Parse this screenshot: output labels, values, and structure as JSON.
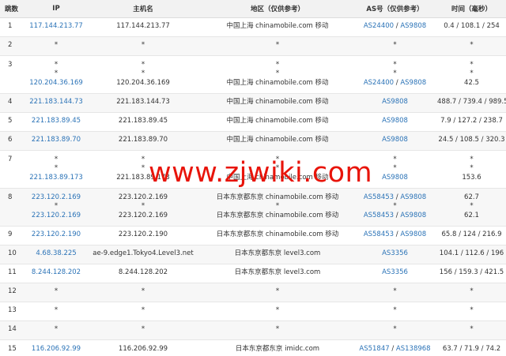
{
  "headers": {
    "hop": "跳数",
    "ip": "IP",
    "host": "主机名",
    "region": "地区（仅供参考）",
    "as": "AS号（仅供参考）",
    "time": "时间（毫秒）"
  },
  "rows": [
    {
      "hop": "1",
      "lines": [
        {
          "ip": "117.144.213.77",
          "host": "117.144.213.77",
          "region": "中国上海 chinamobile.com 移动",
          "as": [
            "AS24400",
            "AS9808"
          ],
          "time": "0.4 / 108.1 / 254"
        }
      ]
    },
    {
      "hop": "2",
      "lines": [
        {
          "ip": "*",
          "host": "*",
          "region": "*",
          "as": [
            "*"
          ],
          "time": "*"
        }
      ]
    },
    {
      "hop": "3",
      "lines": [
        {
          "ip": "*",
          "host": "*",
          "region": "*",
          "as": [
            "*"
          ],
          "time": "*"
        },
        {
          "ip": "*",
          "host": "*",
          "region": "*",
          "as": [
            "*"
          ],
          "time": "*"
        },
        {
          "ip": "120.204.36.169",
          "host": "120.204.36.169",
          "region": "中国上海 chinamobile.com 移动",
          "as": [
            "AS24400",
            "AS9808"
          ],
          "time": "42.5"
        }
      ]
    },
    {
      "hop": "4",
      "lines": [
        {
          "ip": "221.183.144.73",
          "host": "221.183.144.73",
          "region": "中国上海 chinamobile.com 移动",
          "as": [
            "AS9808"
          ],
          "time": "488.7 / 739.4 / 989.5"
        }
      ]
    },
    {
      "hop": "5",
      "lines": [
        {
          "ip": "221.183.89.45",
          "host": "221.183.89.45",
          "region": "中国上海 chinamobile.com 移动",
          "as": [
            "AS9808"
          ],
          "time": "7.9 / 127.2 / 238.7"
        }
      ]
    },
    {
      "hop": "6",
      "lines": [
        {
          "ip": "221.183.89.70",
          "host": "221.183.89.70",
          "region": "中国上海 chinamobile.com 移动",
          "as": [
            "AS9808"
          ],
          "time": "24.5 / 108.5 / 320.3"
        }
      ]
    },
    {
      "hop": "7",
      "lines": [
        {
          "ip": "*",
          "host": "*",
          "region": "*",
          "as": [
            "*"
          ],
          "time": "*"
        },
        {
          "ip": "*",
          "host": "*",
          "region": "*",
          "as": [
            "*"
          ],
          "time": "*"
        },
        {
          "ip": "221.183.89.173",
          "host": "221.183.89.173",
          "region": "中国上海 chinamobile.com 移动",
          "as": [
            "AS9808"
          ],
          "time": "153.6"
        }
      ]
    },
    {
      "hop": "8",
      "lines": [
        {
          "ip": "223.120.2.169",
          "host": "223.120.2.169",
          "region": "日本东京都东京 chinamobile.com 移动",
          "as": [
            "AS58453",
            "AS9808"
          ],
          "time": "62.7"
        },
        {
          "ip": "*",
          "host": "*",
          "region": "*",
          "as": [
            "*"
          ],
          "time": "*"
        },
        {
          "ip": "223.120.2.169",
          "host": "223.120.2.169",
          "region": "日本东京都东京 chinamobile.com 移动",
          "as": [
            "AS58453",
            "AS9808"
          ],
          "time": "62.1"
        }
      ]
    },
    {
      "hop": "9",
      "lines": [
        {
          "ip": "223.120.2.190",
          "host": "223.120.2.190",
          "region": "日本东京都东京 chinamobile.com 移动",
          "as": [
            "AS58453",
            "AS9808"
          ],
          "time": "65.8 / 124 / 216.9"
        }
      ]
    },
    {
      "hop": "10",
      "lines": [
        {
          "ip": "4.68.38.225",
          "host": "ae-9.edge1.Tokyo4.Level3.net",
          "region": "日本东京都东京 level3.com",
          "as": [
            "AS3356"
          ],
          "time": "104.1 / 112.6 / 196"
        }
      ]
    },
    {
      "hop": "11",
      "lines": [
        {
          "ip": "8.244.128.202",
          "host": "8.244.128.202",
          "region": "日本东京都东京 level3.com",
          "as": [
            "AS3356"
          ],
          "time": "156 / 159.3 / 421.5"
        }
      ]
    },
    {
      "hop": "12",
      "lines": [
        {
          "ip": "*",
          "host": "*",
          "region": "*",
          "as": [
            "*"
          ],
          "time": "*"
        }
      ]
    },
    {
      "hop": "13",
      "lines": [
        {
          "ip": "*",
          "host": "*",
          "region": "*",
          "as": [
            "*"
          ],
          "time": "*"
        }
      ]
    },
    {
      "hop": "14",
      "lines": [
        {
          "ip": "*",
          "host": "*",
          "region": "*",
          "as": [
            "*"
          ],
          "time": "*"
        }
      ]
    },
    {
      "hop": "15",
      "lines": [
        {
          "ip": "116.206.92.99",
          "host": "116.206.92.99",
          "region": "日本东京都东京 imidc.com",
          "as": [
            "AS51847",
            "AS138968"
          ],
          "time": "63.7 / 71.9 / 74.2"
        }
      ]
    }
  ],
  "watermark": "www.zjwiki.com"
}
